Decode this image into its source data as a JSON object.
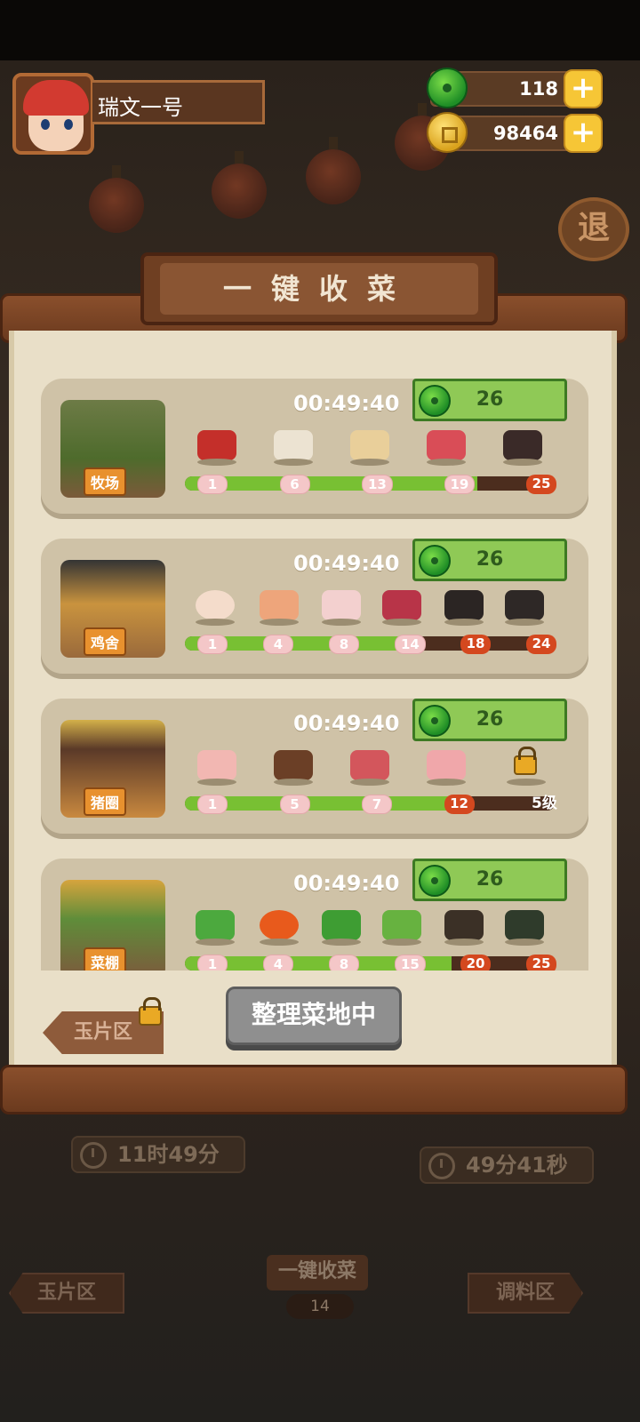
{
  "player": {
    "name": "瑞文一号"
  },
  "currency": {
    "jade": "118",
    "gold": "98464"
  },
  "panel": {
    "title": "一键收菜"
  },
  "cards": [
    {
      "label": "牧场",
      "timer": "00:49:40",
      "reward": "26",
      "progress": 0.79,
      "milestones": [
        "1",
        "6",
        "13",
        "19",
        "25"
      ]
    },
    {
      "label": "鸡舍",
      "timer": "00:49:40",
      "reward": "26",
      "progress": 0.63,
      "milestones": [
        "1",
        "4",
        "8",
        "14",
        "18",
        "24"
      ]
    },
    {
      "label": "猪圈",
      "timer": "00:49:40",
      "reward": "26",
      "progress": 0.73,
      "milestones": [
        "1",
        "5",
        "7",
        "12",
        "5级"
      ]
    },
    {
      "label": "菜棚",
      "timer": "00:49:40",
      "reward": "26",
      "progress": 0.72,
      "milestones": [
        "1",
        "4",
        "8",
        "15",
        "20",
        "25"
      ]
    }
  ],
  "buttons": {
    "jade_zone": "玉片区",
    "organize": "整理菜地中"
  },
  "bottom": {
    "timer_left": "11时49分",
    "timer_right": "49分41秒",
    "tab_left": "玉片区",
    "tab_center": "一键收菜",
    "tab_center_count": "14",
    "tab_right": "调料区"
  },
  "colors": {
    "progress_fill": "#78c033",
    "reward_bg": "#8fc956",
    "gold_plus": "#f6c636"
  }
}
